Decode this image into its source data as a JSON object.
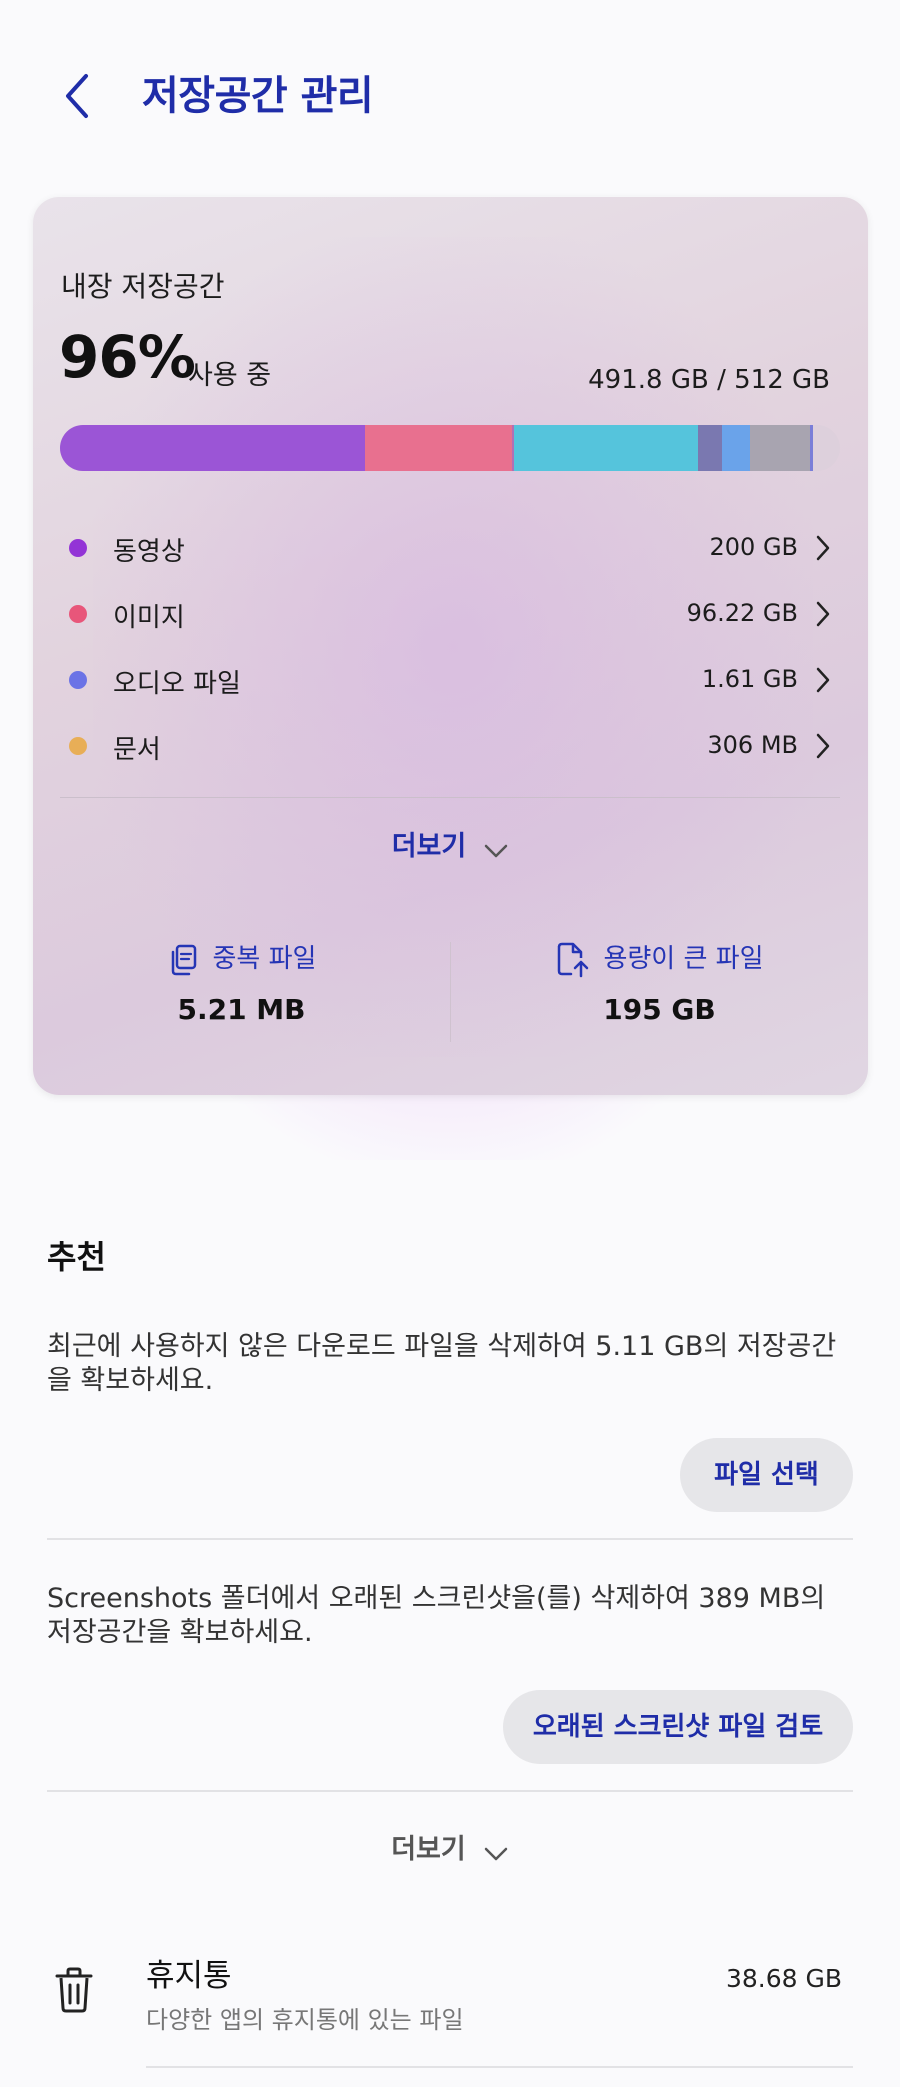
{
  "header": {
    "title": "저장공간 관리",
    "back_icon": "chevron-left-icon"
  },
  "storage": {
    "label": "내장 저장공간",
    "percent": "96%",
    "percent_suffix": "사용 중",
    "total": "491.8 GB / 512 GB",
    "bar_segments": [
      {
        "name": "videos",
        "fraction": 0.391,
        "color": "#9b55d6"
      },
      {
        "name": "images",
        "fraction": 0.188,
        "color": "#e8708f"
      },
      {
        "name": "other-1",
        "fraction": 0.003,
        "color": "#b070b5"
      },
      {
        "name": "apps",
        "fraction": 0.236,
        "color": "#55c4dc"
      },
      {
        "name": "other-2",
        "fraction": 0.031,
        "color": "#7a78b0"
      },
      {
        "name": "other-3",
        "fraction": 0.036,
        "color": "#6aa3ea"
      },
      {
        "name": "system",
        "fraction": 0.077,
        "color": "#a8a4b0"
      },
      {
        "name": "other-4",
        "fraction": 0.003,
        "color": "#7a7ed8"
      }
    ],
    "categories": [
      {
        "name": "동영상",
        "size": "200 GB",
        "color": "#9334d6"
      },
      {
        "name": "이미지",
        "size": "96.22 GB",
        "color": "#e8567a"
      },
      {
        "name": "오디오 파일",
        "size": "1.61 GB",
        "color": "#6b73e6"
      },
      {
        "name": "문서",
        "size": "306 MB",
        "color": "#e8ae57"
      }
    ],
    "more_label": "더보기",
    "duplicate": {
      "label": "중복 파일",
      "value": "5.21 MB",
      "icon": "duplicate-file-icon"
    },
    "large": {
      "label": "용량이 큰 파일",
      "value": "195 GB",
      "icon": "large-file-icon"
    }
  },
  "recommendations": {
    "title": "추천",
    "items": [
      {
        "text": "최근에 사용하지 않은 다운로드 파일을 삭제하여 5.11 GB의 저장공간을 확보하세요.",
        "button": "파일 선택"
      },
      {
        "text": "Screenshots 폴더에서 오래된 스크린샷을(를) 삭제하여 389 MB의 저장공간을 확보하세요.",
        "button": "오래된 스크린샷 파일 검토"
      }
    ],
    "more_label": "더보기"
  },
  "trash": {
    "title": "휴지통",
    "subtitle": "다양한 앱의 휴지통에 있는 파일",
    "size": "38.68 GB",
    "icon": "trash-icon"
  },
  "colors": {
    "accent": "#1f2da8",
    "background": "#fafafc"
  }
}
